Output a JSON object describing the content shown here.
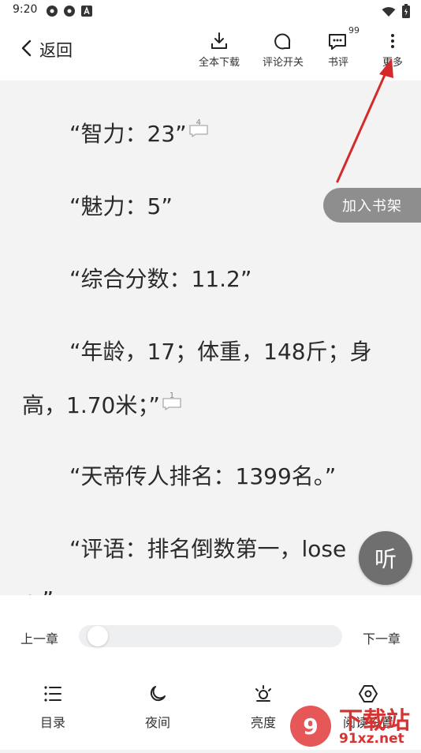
{
  "status_bar": {
    "time": "9:20",
    "icons": [
      "app-icon",
      "app-icon",
      "a-icon"
    ],
    "right_icons": [
      "wifi-icon",
      "battery-icon"
    ]
  },
  "top_bar": {
    "back_label": "返回",
    "download_label": "全本下载",
    "comment_toggle_label": "评论开关",
    "review_label": "书评",
    "review_badge": "99",
    "more_label": "更多"
  },
  "content": {
    "paragraphs": [
      {
        "text": "“智力：23”",
        "comment_count": "4"
      },
      {
        "text": "“魅力：5”"
      },
      {
        "text": "“综合分数：11.2”"
      },
      {
        "text": "“年龄，17；体重，148斤；身"
      },
      {
        "text": "高，1.70米；”",
        "comment_count": "1"
      },
      {
        "text": "“天帝传人排名：1399名。”"
      },
      {
        "text": "“评语：排名倒数第一，lose"
      },
      {
        "text": "r。”"
      }
    ],
    "add_shelf_label": "加入书架",
    "listen_label": "听"
  },
  "bottom_panel": {
    "prev_chapter": "上一章",
    "next_chapter": "下一章",
    "progress": 0.03,
    "nav": {
      "toc": "目录",
      "night": "夜间",
      "brightness": "亮度",
      "settings": "阅读设置"
    }
  },
  "colors": {
    "background": "#f3f3f3",
    "panel": "#ffffff",
    "arrow": "#d42a2a",
    "floating": "#6f6f6f"
  },
  "watermark": {
    "text": "下载站",
    "url_text": "91xz.net"
  }
}
